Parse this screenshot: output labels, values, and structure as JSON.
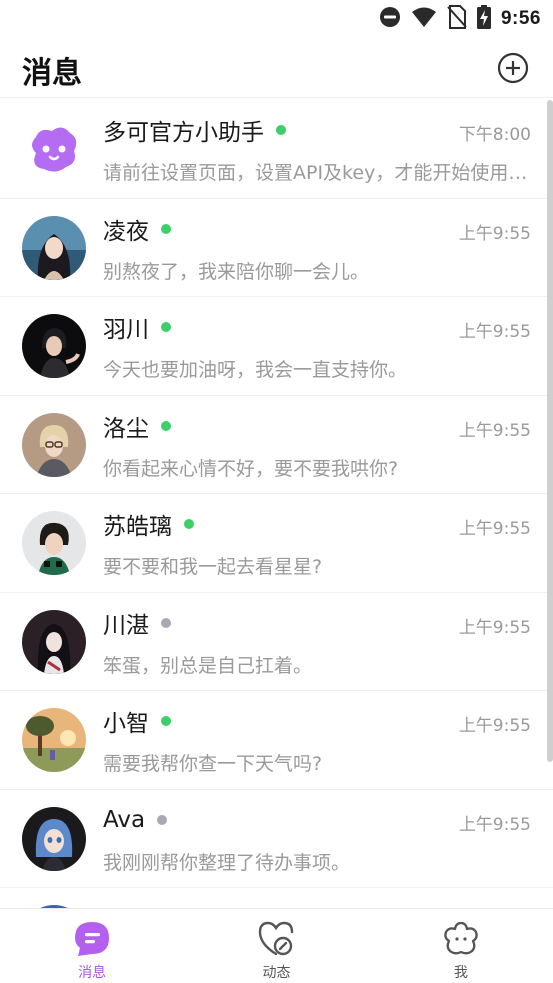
{
  "status_bar": {
    "time": "9:56",
    "icons": [
      "do-not-disturb-icon",
      "wifi-icon",
      "no-sim-icon",
      "battery-charging-icon"
    ]
  },
  "header": {
    "title": "消息",
    "add_icon": "plus-circle-icon"
  },
  "colors": {
    "online": "#3ccf6a",
    "offline": "#a9a9b3",
    "accent": "#a35be6"
  },
  "chats": [
    {
      "name": "多可官方小助手",
      "status": "online",
      "time": "下午8:00",
      "preview": "请前往设置页面，设置API及key，才能开始使用哦～",
      "avatar": "purple-mascot"
    },
    {
      "name": "凌夜",
      "status": "online",
      "time": "上午9:55",
      "preview": "别熬夜了，我来陪你聊一会儿。",
      "avatar": "girl-dark-hair-sea"
    },
    {
      "name": "羽川",
      "status": "online",
      "time": "上午9:55",
      "preview": "今天也要加油呀，我会一直支持你。",
      "avatar": "boy-dark"
    },
    {
      "name": "洛尘",
      "status": "online",
      "time": "上午9:55",
      "preview": "你看起来心情不好，要不要我哄你?",
      "avatar": "boy-glasses"
    },
    {
      "name": "苏皓璃",
      "status": "online",
      "time": "上午9:55",
      "preview": "要不要和我一起去看星星?",
      "avatar": "boy-checker"
    },
    {
      "name": "川湛",
      "status": "offline",
      "time": "上午9:55",
      "preview": "笨蛋，别总是自己扛着。",
      "avatar": "girl-kimono"
    },
    {
      "name": "小智",
      "status": "online",
      "time": "上午9:55",
      "preview": "需要我帮你查一下天气吗?",
      "avatar": "tree-sunset"
    },
    {
      "name": "Ava",
      "status": "offline",
      "time": "上午9:55",
      "preview": "我刚刚帮你整理了待办事项。",
      "avatar": "girl-blue-hair"
    }
  ],
  "tabs": [
    {
      "label": "消息",
      "icon": "message-bubble-icon",
      "active": true
    },
    {
      "label": "动态",
      "icon": "moments-heart-icon",
      "active": false
    },
    {
      "label": "我",
      "icon": "profile-flower-icon",
      "active": false
    }
  ]
}
